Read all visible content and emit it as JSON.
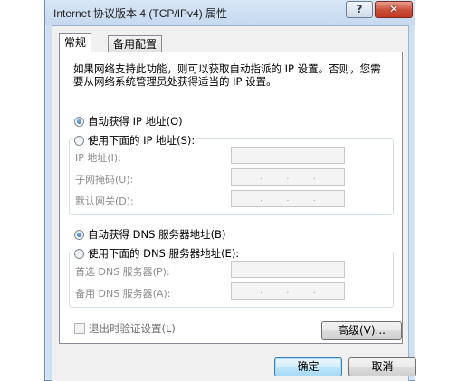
{
  "window": {
    "title": "Internet 协议版本 4 (TCP/IPv4) 属性",
    "help_label": "?",
    "close_label": "✕"
  },
  "tabs": [
    {
      "label": "常规",
      "active": true
    },
    {
      "label": "备用配置",
      "active": false
    }
  ],
  "intro_text": "如果网络支持此功能，则可以获取自动指派的 IP 设置。否则，您需要从网络系统管理员处获得适当的 IP 设置。",
  "ip_section": {
    "auto_option": {
      "label": "自动获得 IP 地址(O)",
      "selected": true
    },
    "manual_option": {
      "label": "使用下面的 IP 地址(S):",
      "selected": false
    },
    "fields": [
      {
        "label": "IP 地址(I):",
        "value": ". . ."
      },
      {
        "label": "子网掩码(U):",
        "value": ". . ."
      },
      {
        "label": "默认网关(D):",
        "value": ". . ."
      }
    ]
  },
  "dns_section": {
    "auto_option": {
      "label": "自动获得 DNS 服务器地址(B)",
      "selected": true
    },
    "manual_option": {
      "label": "使用下面的 DNS 服务器地址(E):",
      "selected": false
    },
    "fields": [
      {
        "label": "首选 DNS 服务器(P):",
        "value": ". . ."
      },
      {
        "label": "备用 DNS 服务器(A):",
        "value": ". . ."
      }
    ]
  },
  "validate_checkbox": {
    "label": "退出时验证设置(L)",
    "checked": false
  },
  "buttons": {
    "advanced": "高级(V)...",
    "ok": "确定",
    "cancel": "取消"
  }
}
